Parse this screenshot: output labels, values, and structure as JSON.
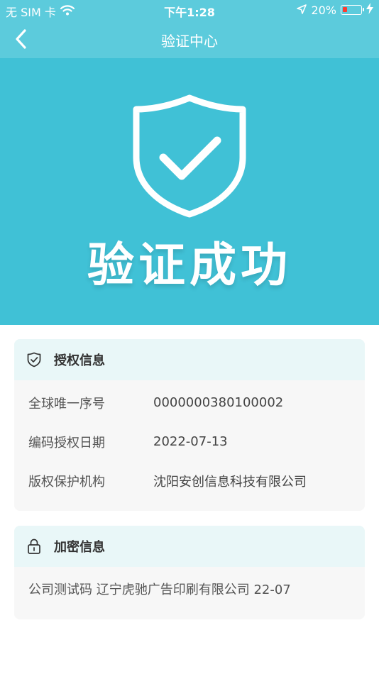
{
  "status_bar": {
    "carrier": "无 SIM 卡",
    "time": "下午1:28",
    "battery": "20%"
  },
  "nav": {
    "title": "验证中心"
  },
  "hero": {
    "text": "验证成功"
  },
  "auth_card": {
    "title": "授权信息",
    "rows": [
      {
        "label": "全球唯一序号",
        "value": "0000000380100002"
      },
      {
        "label": "编码授权日期",
        "value": "2022-07-13"
      },
      {
        "label": "版权保护机构",
        "value": "沈阳安创信息科技有限公司"
      }
    ]
  },
  "encrypt_card": {
    "title": "加密信息",
    "content": "公司测试码 辽宁虎驰广告印刷有限公司 22-07"
  },
  "colors": {
    "header_bg": "#5ccbdc",
    "hero_bg": "#40c1d6",
    "card_bg": "#f7f7f7",
    "card_header_bg": "#e9f7f8"
  },
  "icons": {
    "back": "chevron-left-icon",
    "wifi": "wifi-icon",
    "location": "location-arrow-icon",
    "charging": "lightning-icon",
    "shield": "shield-check-icon",
    "auth": "shield-check-icon",
    "lock": "lock-icon"
  }
}
